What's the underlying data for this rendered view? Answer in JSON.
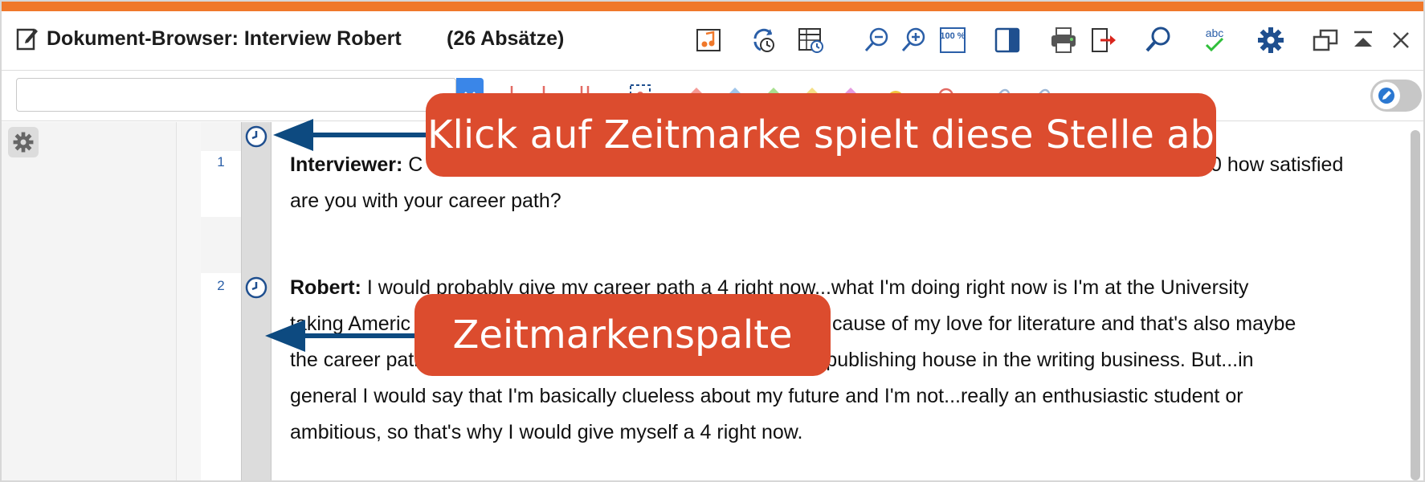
{
  "window": {
    "title": "Dokument-Browser: Interview Robert",
    "paragraph_count": "(26 Absätze)",
    "accent_color": "#f0782a"
  },
  "toolbar": {
    "icons": [
      "media-player-icon",
      "sync-timestamp-icon",
      "timestamp-table-icon",
      "zoom-out-icon",
      "zoom-in-icon",
      "zoom-100-icon",
      "panel-toggle-icon",
      "print-icon",
      "export-icon",
      "search-icon",
      "spellcheck-icon",
      "settings-gear-icon",
      "undock-window-icon",
      "collapse-window-icon",
      "close-icon"
    ],
    "zoom_100_label": "100 %",
    "spellcheck_label": "abc"
  },
  "codebar": {
    "input_value": "",
    "icons": [
      "code-marker-icon",
      "code-marker-icon",
      "code-marker-icon",
      "selection-code-icon",
      "red-color-code-icon",
      "blue-color-code-icon",
      "green-color-code-icon",
      "yellow-color-code-icon",
      "magenta-color-code-icon",
      "emoji-code-icon",
      "undo-code-icon",
      "link-icon",
      "link-icon"
    ],
    "toggle_state": "off"
  },
  "document": {
    "paragraphs": [
      {
        "number": "1",
        "speaker": "Interviewer:",
        "line1_visible_start": "C",
        "line1_visible_end": "0 how satisfied",
        "line2": "are you with your career path?"
      },
      {
        "number": "2",
        "speaker": "Robert:",
        "line1": "I would probably give my career path a 4 right now...what I'm doing right now is I'm at the University",
        "line2_visible_start": "taking Americ",
        "line2_visible_end": "cause of my love for literature and that's also maybe",
        "line3_visible_start": "the career path",
        "line3_visible_end": "like a publishing house in the writing business. But...in",
        "line4": "general I would say that I'm basically clueless about my future and I'm not...really an enthusiastic student or",
        "line5": "ambitious, so that's why I would give myself a 4 right now."
      }
    ]
  },
  "annotations": {
    "callout_1": "Klick auf Zeitmarke spielt diese Stelle ab",
    "callout_2": "Zeitmarkenspalte",
    "callout_color": "#dc4c2e",
    "arrow_color": "#0d4a80"
  }
}
